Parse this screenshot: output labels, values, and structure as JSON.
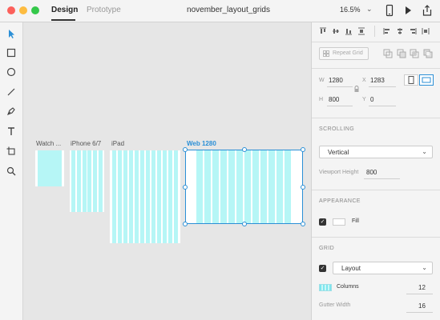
{
  "titlebar": {
    "tab_design": "Design",
    "tab_prototype": "Prototype",
    "document_title": "november_layout_grids",
    "zoom": "16.5%",
    "icons": [
      "device-preview-icon",
      "play-icon",
      "share-icon"
    ]
  },
  "toolbar": {
    "tools": [
      "select-arrow-icon",
      "rectangle-icon",
      "ellipse-icon",
      "line-icon",
      "pen-icon",
      "text-icon",
      "artboard-icon",
      "zoom-icon"
    ]
  },
  "canvas": {
    "artboards": [
      {
        "label": "Watch ...",
        "columns": 1,
        "selected": false
      },
      {
        "label": "iPhone 6/7",
        "columns": 6,
        "selected": false
      },
      {
        "label": "iPad",
        "columns": 12,
        "selected": false
      },
      {
        "label": "Web 1280",
        "columns": 12,
        "selected": true
      }
    ],
    "grid_color": "#b6f6f6",
    "selection_color": "#2b8fd6"
  },
  "panel": {
    "repeat_grid_label": "Repeat Grid",
    "width_label": "W",
    "width_value": "1280",
    "x_label": "X",
    "x_value": "1283",
    "height_label": "H",
    "height_value": "800",
    "y_label": "Y",
    "y_value": "0",
    "scrolling": {
      "title": "SCROLLING",
      "selected": "Vertical",
      "viewport_label": "Viewport Height",
      "viewport_value": "800"
    },
    "appearance": {
      "title": "APPEARANCE",
      "fill_label": "Fill",
      "fill_checked": true
    },
    "grid": {
      "title": "GRID",
      "checked": true,
      "type": "Layout",
      "columns_label": "Columns",
      "columns_value": "12",
      "gutter_label": "Gutter Width",
      "gutter_value": "16"
    }
  }
}
